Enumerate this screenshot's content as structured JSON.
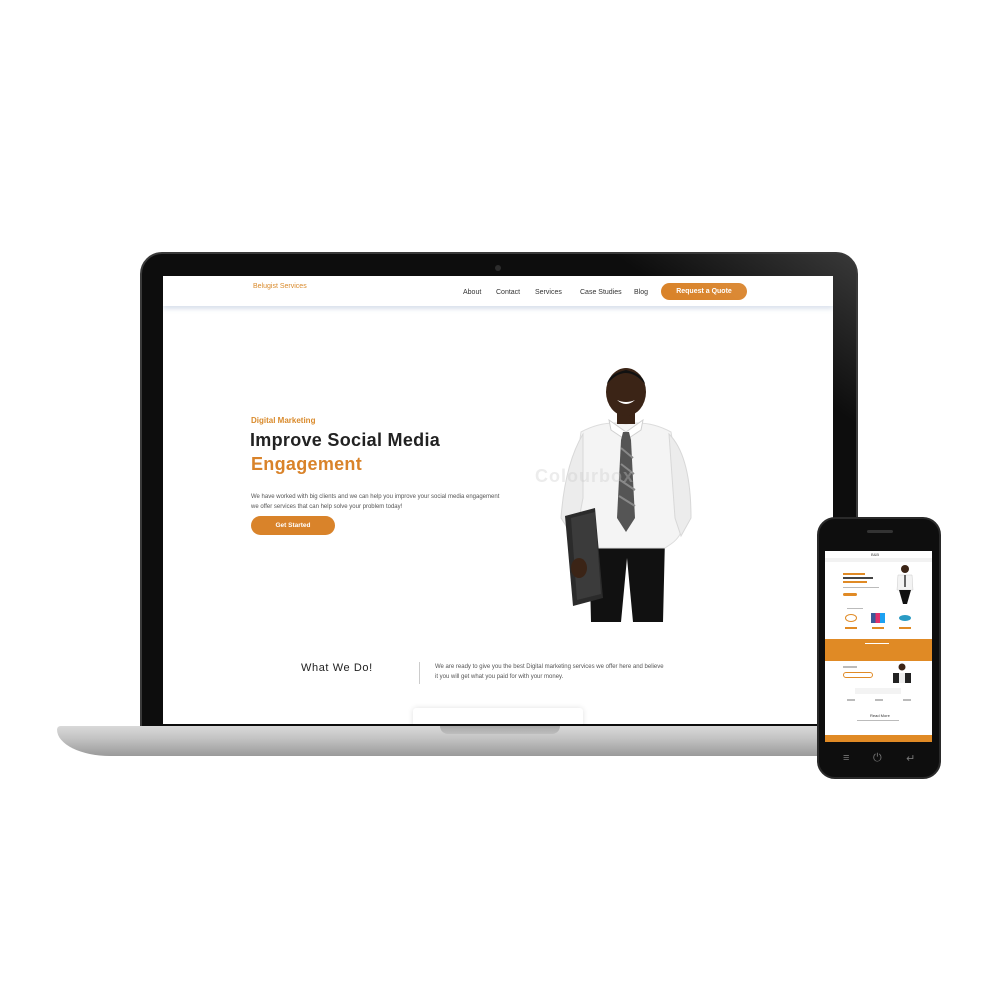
{
  "site": {
    "logo": "Belugist Services",
    "nav": [
      "About",
      "Contact",
      "Services",
      "Case Studies",
      "Blog"
    ],
    "cta": "Request a Quote"
  },
  "hero": {
    "kicker": "Digital Marketing",
    "title_line1": "Improve Social Media",
    "title_line2": "Engagement",
    "description": "We have worked with big clients and we can help you improve your social media engagement we offer services that can help solve your problem today!",
    "button": "Get Started",
    "watermark": "Colourbox"
  },
  "what_we_do": {
    "title": "What We Do!",
    "description": "We are ready to give you the best Digital marketing services we offer here and believe it you will get what you paid for with your money."
  },
  "phone": {
    "brand": "B&B",
    "section_label": "Read More",
    "home_icon": "power-icon",
    "menu_icon": "menu-icon",
    "back_icon": "back-icon"
  },
  "colors": {
    "accent": "#d9832a",
    "text": "#222222",
    "device": "#0d0d0d"
  }
}
